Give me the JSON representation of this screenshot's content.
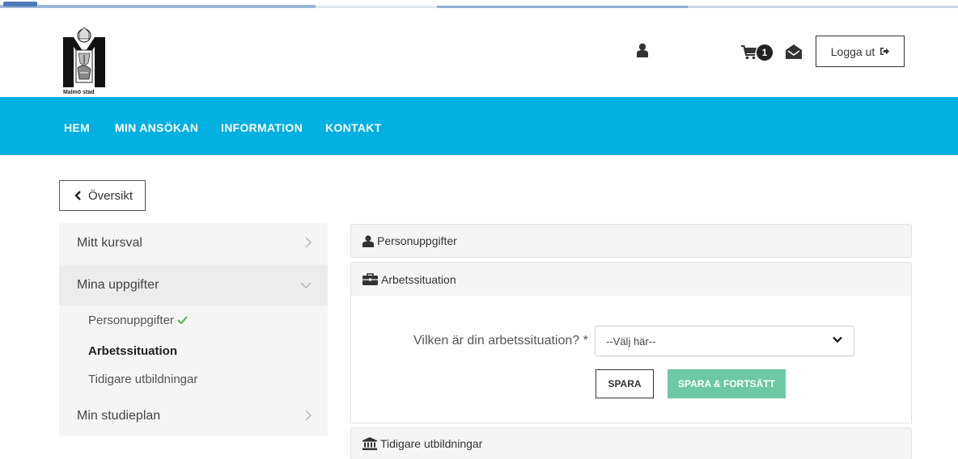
{
  "branding": {
    "logo_text": "Malmö stad"
  },
  "header": {
    "user_icon": "user-icon",
    "cart_icon": "shopping-cart-icon",
    "cart_count": "1",
    "mail_icon": "envelope-open-icon",
    "logout_label": "Logga ut",
    "logout_icon": "sign-out-icon"
  },
  "nav": {
    "items": [
      {
        "label": "HEM"
      },
      {
        "label": "MIN ANSÖKAN"
      },
      {
        "label": "INFORMATION"
      },
      {
        "label": "KONTAKT"
      }
    ],
    "background_color": "#00b0e0"
  },
  "back_button": {
    "label": "Översikt",
    "icon": "chevron-left-icon"
  },
  "sidebar": {
    "items": [
      {
        "label": "Mitt kursval",
        "icon": "chevron-right-icon"
      },
      {
        "label": "Mina uppgifter",
        "icon": "chevron-down-icon",
        "expanded": true
      },
      {
        "label": "Min studieplan",
        "icon": "chevron-right-icon"
      }
    ],
    "sub_items": [
      {
        "label": "Personuppgifter",
        "completed": true,
        "icon": "check-icon"
      },
      {
        "label": "Arbetssituation",
        "current": true
      },
      {
        "label": "Tidigare utbildningar"
      }
    ]
  },
  "panels": {
    "personal": {
      "label": "Personuppgifter",
      "icon": "user-icon"
    },
    "work": {
      "label": "Arbetssituation",
      "icon": "briefcase-icon",
      "expanded": true
    },
    "education": {
      "label": "Tidigare utbildningar",
      "icon": "institution-icon"
    }
  },
  "form": {
    "question": "Vilken är din arbetssituation? *",
    "select_value": "--Välj här--",
    "save_label": "SPARA",
    "save_continue_label": "SPARA & FORTSÄTT",
    "save_continue_color": "#6cc9a3"
  }
}
